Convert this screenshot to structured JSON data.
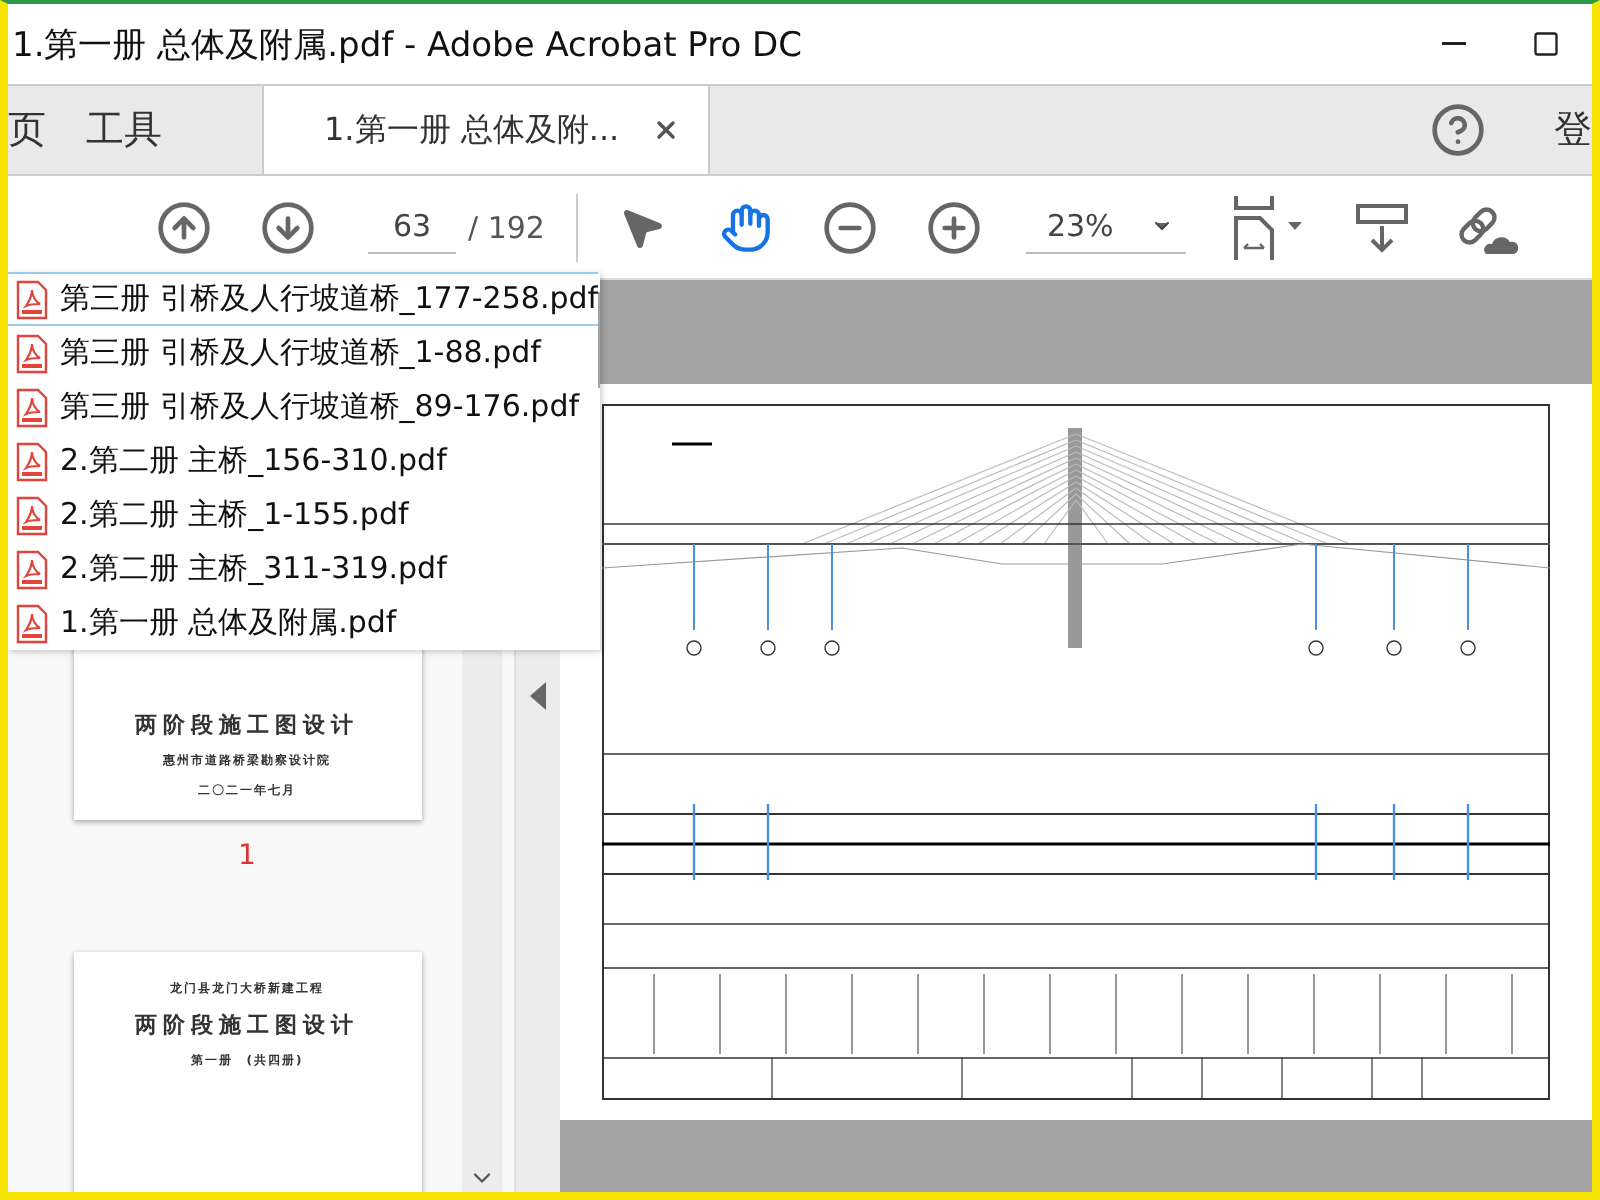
{
  "window": {
    "title": "1.第一册 总体及附属.pdf - Adobe Acrobat Pro DC"
  },
  "tabs": [
    {
      "label": "页",
      "selected": false,
      "closable": false
    },
    {
      "label": "工具",
      "selected": false,
      "closable": false
    },
    {
      "label": "1.第一册 总体及附...",
      "selected": true,
      "closable": true
    }
  ],
  "account": {
    "label": "登"
  },
  "toolbar": {
    "page": "63",
    "total": "/ 192",
    "zoom": "23%",
    "tools": [
      {
        "kind": "select",
        "selected": false
      },
      {
        "kind": "hand",
        "selected": true
      }
    ]
  },
  "file_list": [
    {
      "name": "第三册 引桥及人行坡道桥_177-258.pdf",
      "selected": true
    },
    {
      "name": "第三册 引桥及人行坡道桥_1-88.pdf",
      "selected": false
    },
    {
      "name": "第三册 引桥及人行坡道桥_89-176.pdf",
      "selected": false
    },
    {
      "name": "2.第二册 主桥_156-310.pdf",
      "selected": false
    },
    {
      "name": "2.第二册 主桥_1-155.pdf",
      "selected": false
    },
    {
      "name": "2.第二册 主桥_311-319.pdf",
      "selected": false
    },
    {
      "name": "1.第一册 总体及附属.pdf",
      "selected": false
    }
  ],
  "thumbnails": [
    {
      "lines": [
        {
          "kind": "title",
          "text": "两阶段施工图设计"
        },
        {
          "kind": "org",
          "text": "惠州市道路桥梁勘察设计院"
        },
        {
          "kind": "org",
          "text": "二〇二一年七月"
        }
      ],
      "page_label": "1"
    },
    {
      "lines": [
        {
          "kind": "org",
          "text": "龙门县龙门大桥新建工程"
        },
        {
          "kind": "title",
          "text": "两阶段施工图设计"
        },
        {
          "kind": "org",
          "text": "第一册　(共四册)"
        }
      ]
    }
  ]
}
